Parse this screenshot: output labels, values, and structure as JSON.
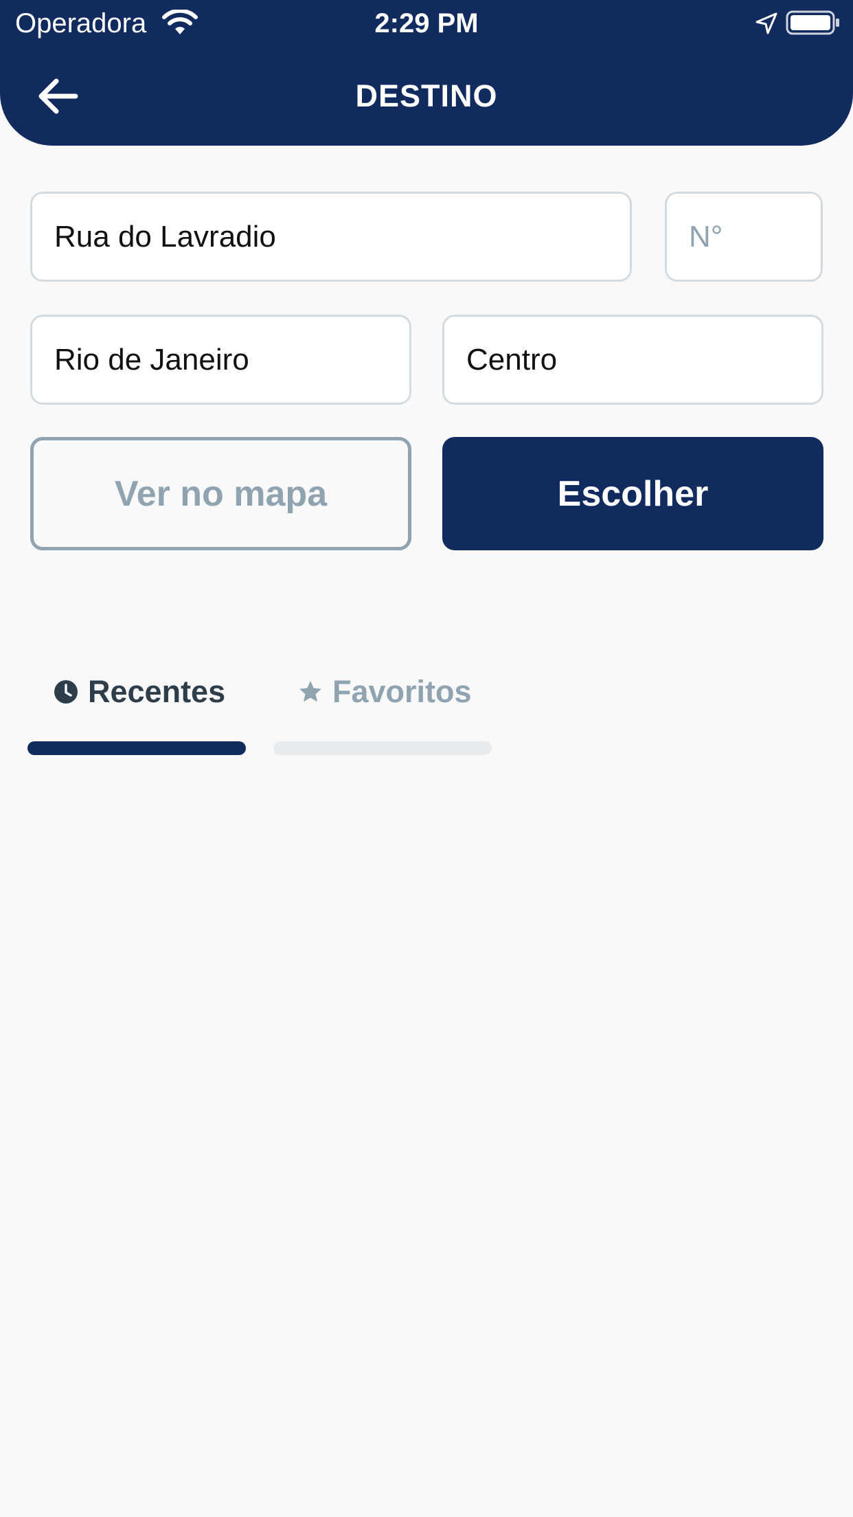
{
  "status_bar": {
    "carrier": "Operadora",
    "time": "2:29 PM",
    "icons": [
      "wifi-icon",
      "location-icon",
      "battery-icon"
    ]
  },
  "header": {
    "title": "DESTINO",
    "back_icon": "arrow-left-icon"
  },
  "form": {
    "street": {
      "value": "Rua do Lavradio",
      "placeholder": ""
    },
    "number": {
      "value": "",
      "placeholder": "N°"
    },
    "city": {
      "value": "Rio de Janeiro",
      "placeholder": ""
    },
    "neighborhood": {
      "value": "Centro",
      "placeholder": ""
    }
  },
  "actions": {
    "view_map_label": "Ver no mapa",
    "choose_label": "Escolher"
  },
  "tabs": [
    {
      "label": "Recentes",
      "icon": "clock-icon",
      "active": true
    },
    {
      "label": "Favoritos",
      "icon": "star-icon",
      "active": false
    }
  ],
  "colors": {
    "primary": "#112b5e",
    "muted": "#8fa3b0",
    "background": "#f9f9f9",
    "text_dark": "#2d3e4a"
  }
}
